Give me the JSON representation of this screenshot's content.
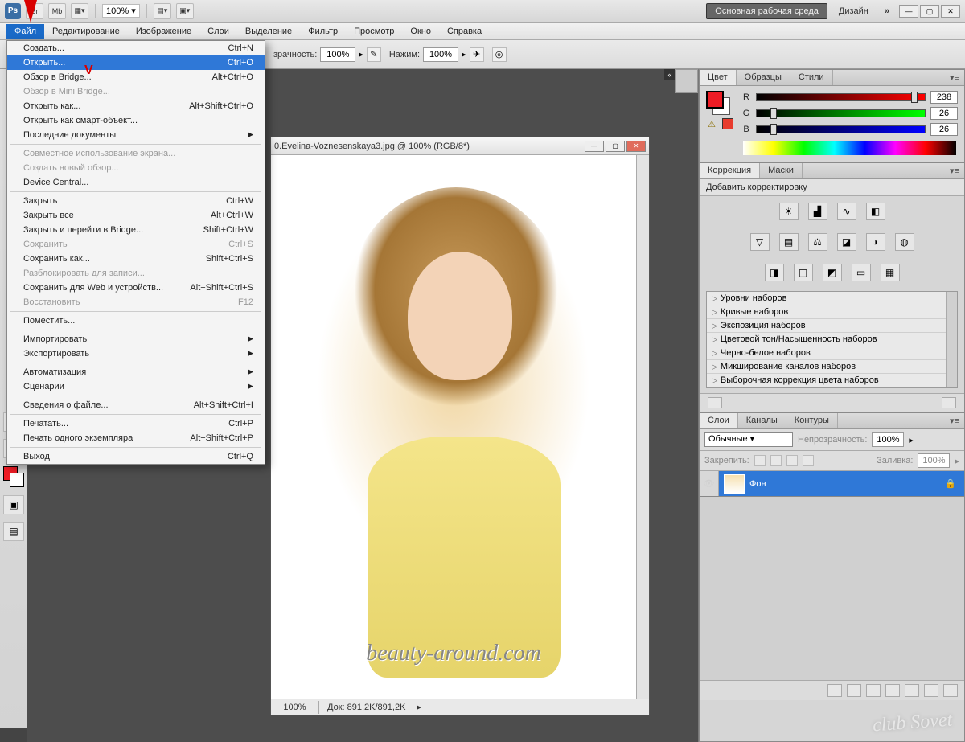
{
  "appbar": {
    "logo": "Ps",
    "br": "Br",
    "mb": "Mb",
    "zoom": "100%",
    "workspace_main": "Основная рабочая среда",
    "workspace_design": "Дизайн",
    "chevrons": "»"
  },
  "menubar": [
    "Файл",
    "Редактирование",
    "Изображение",
    "Слои",
    "Выделение",
    "Фильтр",
    "Просмотр",
    "Окно",
    "Справка"
  ],
  "file_menu": [
    {
      "label": "Создать...",
      "shortcut": "Ctrl+N"
    },
    {
      "label": "Открыть...",
      "shortcut": "Ctrl+O",
      "hl": true
    },
    {
      "label": "Обзор в Bridge...",
      "shortcut": "Alt+Ctrl+O"
    },
    {
      "label": "Обзор в Mini Bridge...",
      "disabled": true
    },
    {
      "label": "Открыть как...",
      "shortcut": "Alt+Shift+Ctrl+O"
    },
    {
      "label": "Открыть как смарт-объект..."
    },
    {
      "label": "Последние документы",
      "sub": true
    },
    {
      "sep": true
    },
    {
      "label": "Совместное использование экрана...",
      "disabled": true
    },
    {
      "label": "Создать новый обзор...",
      "disabled": true
    },
    {
      "label": "Device Central..."
    },
    {
      "sep": true
    },
    {
      "label": "Закрыть",
      "shortcut": "Ctrl+W"
    },
    {
      "label": "Закрыть все",
      "shortcut": "Alt+Ctrl+W"
    },
    {
      "label": "Закрыть и перейти в Bridge...",
      "shortcut": "Shift+Ctrl+W"
    },
    {
      "label": "Сохранить",
      "shortcut": "Ctrl+S",
      "disabled": true
    },
    {
      "label": "Сохранить как...",
      "shortcut": "Shift+Ctrl+S"
    },
    {
      "label": "Разблокировать для записи...",
      "disabled": true
    },
    {
      "label": "Сохранить для Web и устройств...",
      "shortcut": "Alt+Shift+Ctrl+S"
    },
    {
      "label": "Восстановить",
      "shortcut": "F12",
      "disabled": true
    },
    {
      "sep": true
    },
    {
      "label": "Поместить..."
    },
    {
      "sep": true
    },
    {
      "label": "Импортировать",
      "sub": true
    },
    {
      "label": "Экспортировать",
      "sub": true
    },
    {
      "sep": true
    },
    {
      "label": "Автоматизация",
      "sub": true
    },
    {
      "label": "Сценарии",
      "sub": true
    },
    {
      "sep": true
    },
    {
      "label": "Сведения о файле...",
      "shortcut": "Alt+Shift+Ctrl+I"
    },
    {
      "sep": true
    },
    {
      "label": "Печатать...",
      "shortcut": "Ctrl+P"
    },
    {
      "label": "Печать одного экземпляра",
      "shortcut": "Alt+Shift+Ctrl+P"
    },
    {
      "sep": true
    },
    {
      "label": "Выход",
      "shortcut": "Ctrl+Q"
    }
  ],
  "options": {
    "opacity_label": "зрачность:",
    "opacity_val": "100%",
    "flow_label": "Нажим:",
    "flow_val": "100%"
  },
  "document": {
    "tab": "0.Evelina-Voznesenskaya3.jpg @ 100% (RGB/8*)",
    "title": "0.Evelina-Voznesenskaya3.jpg @ 100% (RGB/8*)",
    "zoom": "100%",
    "info": "Док: 891,2K/891,2K",
    "watermark": "beauty-around.com"
  },
  "panels": {
    "color": {
      "tabs": [
        "Цвет",
        "Образцы",
        "Стили"
      ],
      "r": {
        "label": "R",
        "val": "238"
      },
      "g": {
        "label": "G",
        "val": "26"
      },
      "b": {
        "label": "B",
        "val": "26"
      }
    },
    "adjustments": {
      "tabs": [
        "Коррекция",
        "Маски"
      ],
      "header": "Добавить корректировку",
      "presets": [
        "Уровни наборов",
        "Кривые наборов",
        "Экспозиция наборов",
        "Цветовой тон/Насыщенность наборов",
        "Черно-белое наборов",
        "Микширование каналов наборов",
        "Выборочная коррекция цвета наборов"
      ]
    },
    "layers": {
      "tabs": [
        "Слои",
        "Каналы",
        "Контуры"
      ],
      "blend": "Обычные",
      "opacity_label": "Непрозрачность:",
      "opacity_val": "100%",
      "lock_label": "Закрепить:",
      "fill_label": "Заливка:",
      "fill_val": "100%",
      "layer_name": "Фон"
    }
  },
  "club_logo": "club Sovet"
}
